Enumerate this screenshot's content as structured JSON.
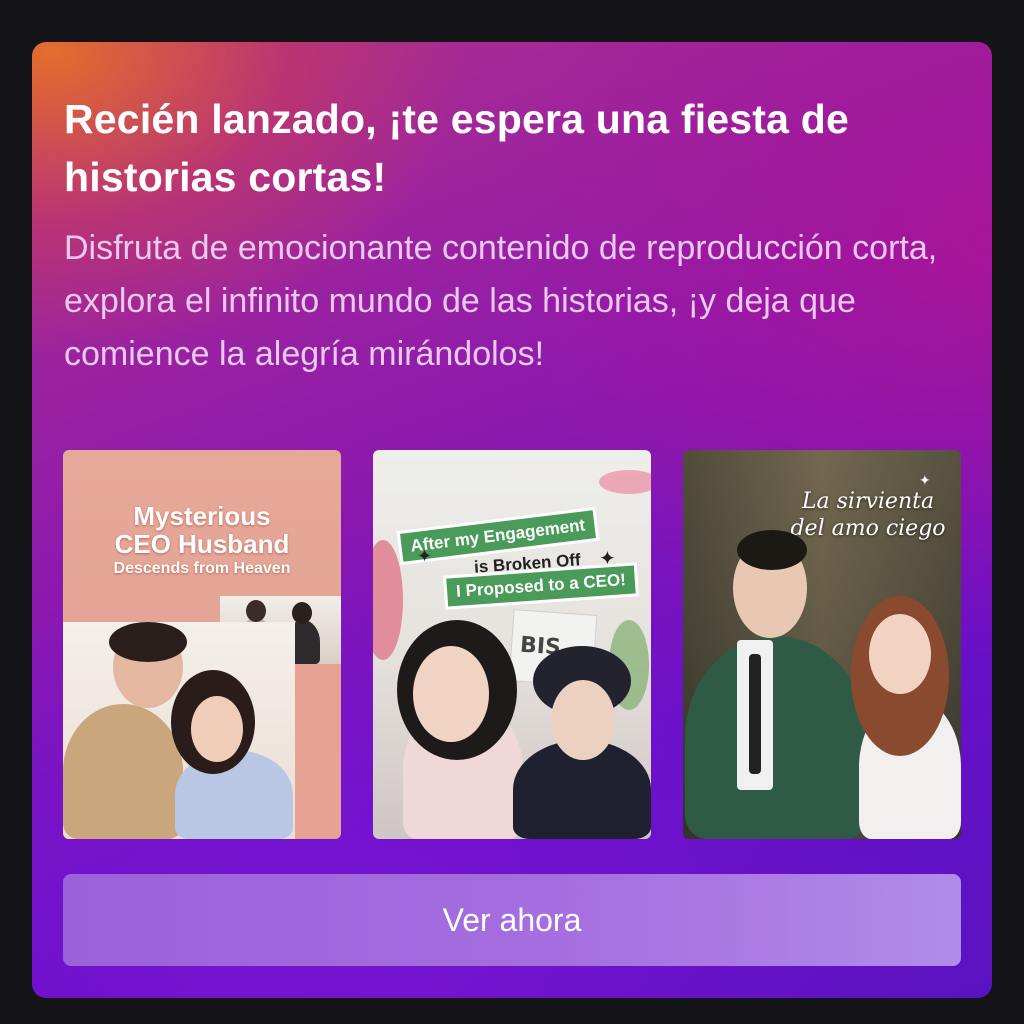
{
  "promo": {
    "title": "Recién lanzado, ¡te espera una fiesta de historias cortas!",
    "description": "Disfruta de emocionante contenido de reproducción corta, explora el infinito mundo de las historias, ¡y deja que comience la alegría mirándolos!",
    "button_label": "Ver ahora"
  },
  "posters": [
    {
      "title_line1": "Mysterious",
      "title_line2": "CEO Husband",
      "title_line3": "Descends from Heaven"
    },
    {
      "line1": "After my Engagement",
      "line2": "is Broken Off",
      "line3": "I Proposed to a CEO!",
      "newspaper_text": "BIS"
    },
    {
      "title_line1": "La sirvienta",
      "title_line2": "del amo ciego"
    }
  ]
}
